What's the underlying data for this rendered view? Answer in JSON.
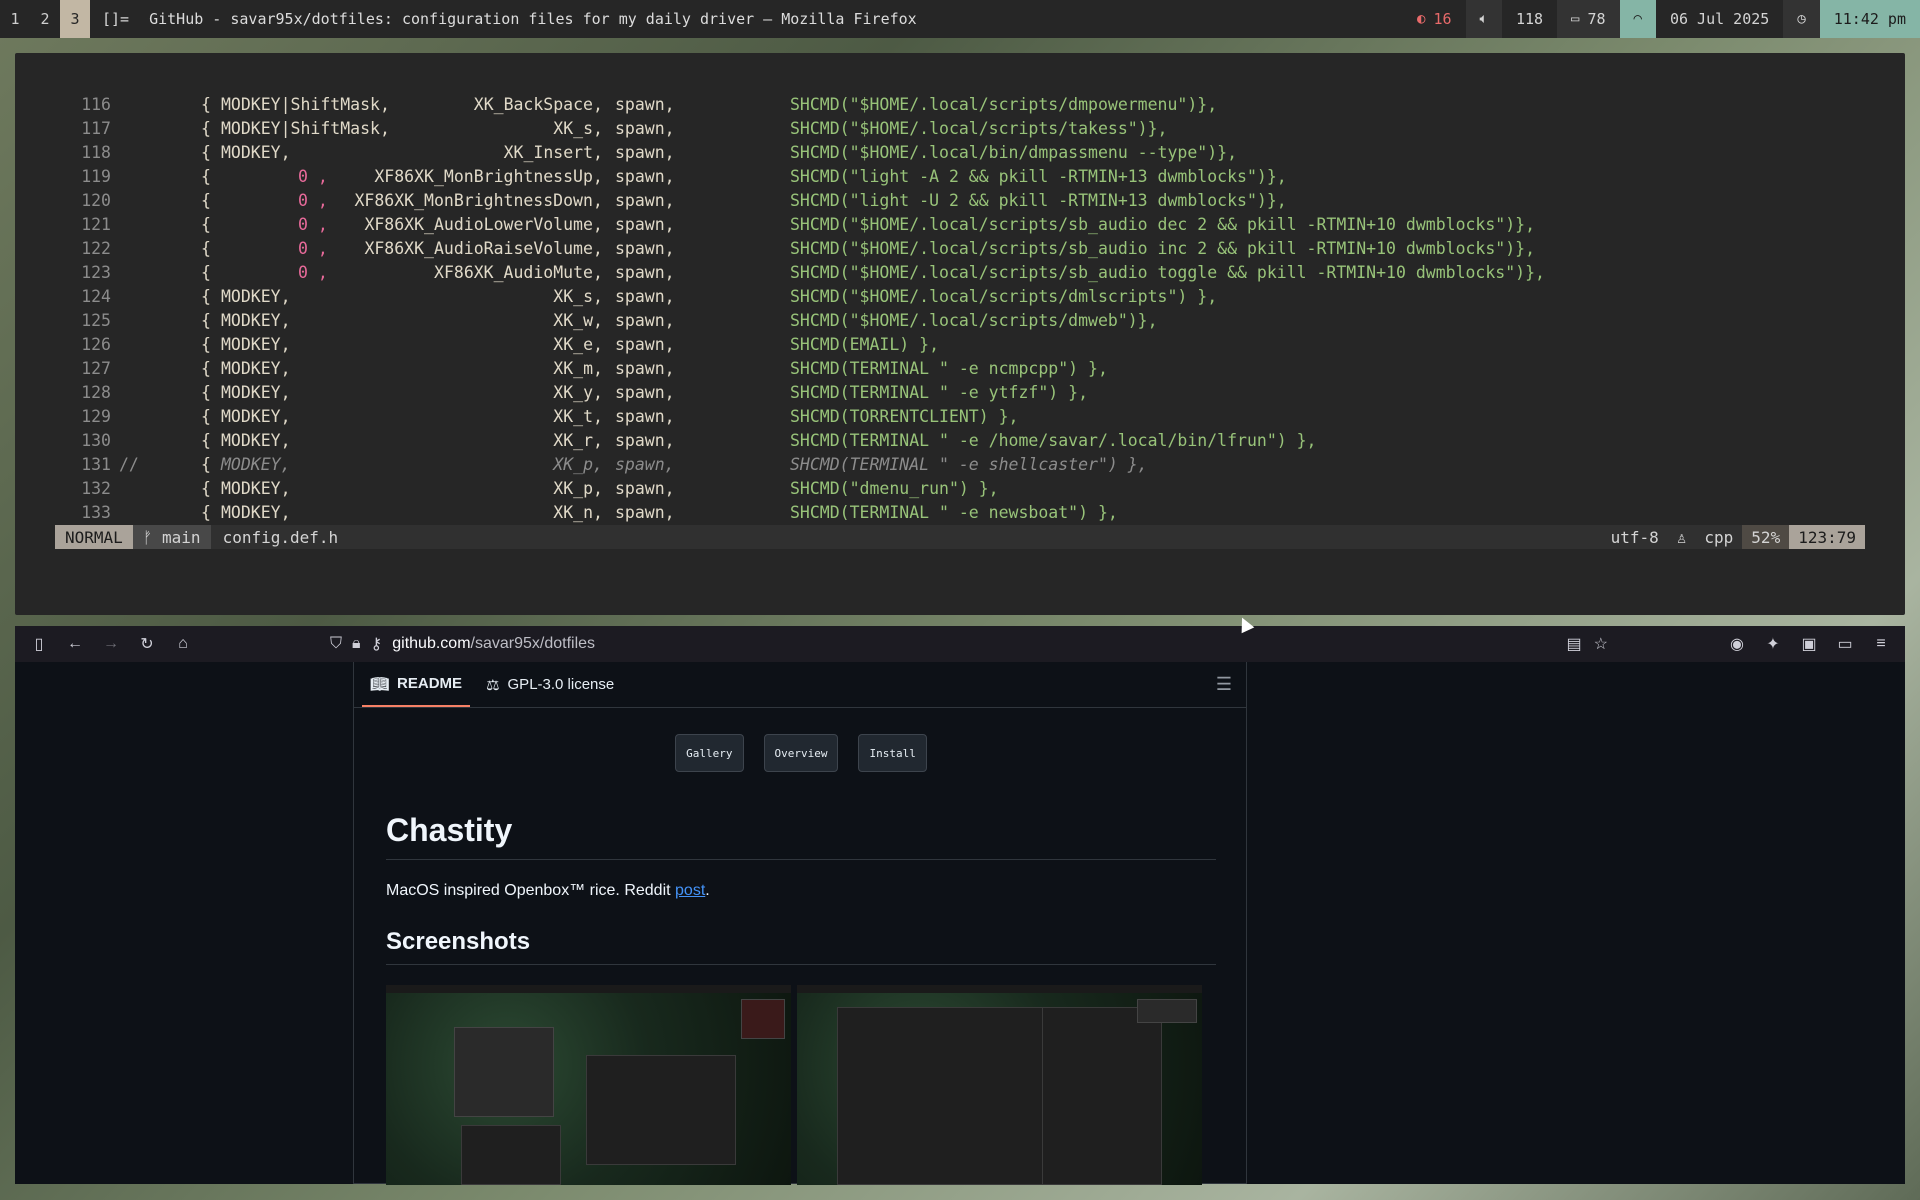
{
  "topbar": {
    "workspaces": [
      "1",
      "2",
      "3"
    ],
    "active_workspace": "3",
    "layout": "[]=",
    "window_title": "GitHub - savar95x/dotfiles: configuration files for my daily driver — Mozilla Firefox",
    "brightness": "16",
    "volume": "118",
    "battery": "78",
    "date": "06 Jul 2025",
    "time": "11:42 pm"
  },
  "editor": {
    "lines": [
      {
        "num": "116",
        "comment": "",
        "modkey": "MODKEY|ShiftMask,",
        "key": "XK_BackSpace,",
        "fn": "spawn,",
        "cmd": "SHCMD(\"$HOME/.local/scripts/dmpowermenu\")},"
      },
      {
        "num": "117",
        "comment": "",
        "modkey": "MODKEY|ShiftMask,",
        "key": "XK_s,",
        "fn": "spawn,",
        "cmd": "SHCMD(\"$HOME/.local/scripts/takess\")},"
      },
      {
        "num": "118",
        "comment": "",
        "modkey": "MODKEY,",
        "key": "XK_Insert,",
        "fn": "spawn,",
        "cmd": "SHCMD(\"$HOME/.local/bin/dmpassmenu --type\")},"
      },
      {
        "num": "119",
        "comment": "",
        "modkey": "0 ,",
        "key": "XF86XK_MonBrightnessUp,",
        "fn": "spawn,",
        "cmd": "SHCMD(\"light -A 2 && pkill -RTMIN+13 dwmblocks\")},"
      },
      {
        "num": "120",
        "comment": "",
        "modkey": "0 ,",
        "key": "XF86XK_MonBrightnessDown,",
        "fn": "spawn,",
        "cmd": "SHCMD(\"light -U 2 && pkill -RTMIN+13 dwmblocks\")},"
      },
      {
        "num": "121",
        "comment": "",
        "modkey": "0 ,",
        "key": "XF86XK_AudioLowerVolume,",
        "fn": "spawn,",
        "cmd": "SHCMD(\"$HOME/.local/scripts/sb_audio dec 2 && pkill -RTMIN+10 dwmblocks\")},"
      },
      {
        "num": "122",
        "comment": "",
        "modkey": "0 ,",
        "key": "XF86XK_AudioRaiseVolume,",
        "fn": "spawn,",
        "cmd": "SHCMD(\"$HOME/.local/scripts/sb_audio inc 2 && pkill -RTMIN+10 dwmblocks\")},"
      },
      {
        "num": "123",
        "comment": "",
        "modkey": "0 ,",
        "key": "XF86XK_AudioMute,",
        "fn": "spawn,",
        "cmd": "SHCMD(\"$HOME/.local/scripts/sb_audio toggle && pkill -RTMIN+10 dwmblocks\")},"
      },
      {
        "num": "124",
        "comment": "",
        "modkey": "MODKEY,",
        "key": "XK_s,",
        "fn": "spawn,",
        "cmd": "SHCMD(\"$HOME/.local/scripts/dmlscripts\") },"
      },
      {
        "num": "125",
        "comment": "",
        "modkey": "MODKEY,",
        "key": "XK_w,",
        "fn": "spawn,",
        "cmd": "SHCMD(\"$HOME/.local/scripts/dmweb\")},"
      },
      {
        "num": "126",
        "comment": "",
        "modkey": "MODKEY,",
        "key": "XK_e,",
        "fn": "spawn,",
        "cmd": "SHCMD(EMAIL) },"
      },
      {
        "num": "127",
        "comment": "",
        "modkey": "MODKEY,",
        "key": "XK_m,",
        "fn": "spawn,",
        "cmd": "SHCMD(TERMINAL \" -e ncmpcpp\") },"
      },
      {
        "num": "128",
        "comment": "",
        "modkey": "MODKEY,",
        "key": "XK_y,",
        "fn": "spawn,",
        "cmd": "SHCMD(TERMINAL \" -e ytfzf\") },"
      },
      {
        "num": "129",
        "comment": "",
        "modkey": "MODKEY,",
        "key": "XK_t,",
        "fn": "spawn,",
        "cmd": "SHCMD(TORRENTCLIENT) },"
      },
      {
        "num": "130",
        "comment": "",
        "modkey": "MODKEY,",
        "key": "XK_r,",
        "fn": "spawn,",
        "cmd": "SHCMD(TERMINAL \" -e /home/savar/.local/bin/lfrun\") },"
      },
      {
        "num": "131",
        "comment": "//",
        "modkey": "MODKEY,",
        "key": "XK_p,",
        "fn": "spawn,",
        "cmd": "SHCMD(TERMINAL \" -e shellcaster\") },"
      },
      {
        "num": "132",
        "comment": "",
        "modkey": "MODKEY,",
        "key": "XK_p,",
        "fn": "spawn,",
        "cmd": "SHCMD(\"dmenu_run\") },"
      },
      {
        "num": "133",
        "comment": "",
        "modkey": "MODKEY,",
        "key": "XK_n,",
        "fn": "spawn,",
        "cmd": "SHCMD(TERMINAL \" -e newsboat\") },"
      }
    ],
    "status": {
      "mode": "NORMAL",
      "branch": "main",
      "filename": "config.def.h",
      "encoding": "utf-8",
      "filetype": "cpp",
      "percent": "52%",
      "position": "123:79"
    }
  },
  "browser": {
    "url_host": "github.com",
    "url_path": "/savar95x/dotfiles",
    "readme_tabs": [
      "README",
      "GPL-3.0 license"
    ],
    "pills": [
      "Gallery",
      "Overview",
      "Install"
    ],
    "heading": "Chastity",
    "paragraph_text": "MacOS inspired Openbox™ rice. Reddit ",
    "paragraph_link": "post",
    "paragraph_end": ".",
    "subheading": "Screenshots"
  }
}
